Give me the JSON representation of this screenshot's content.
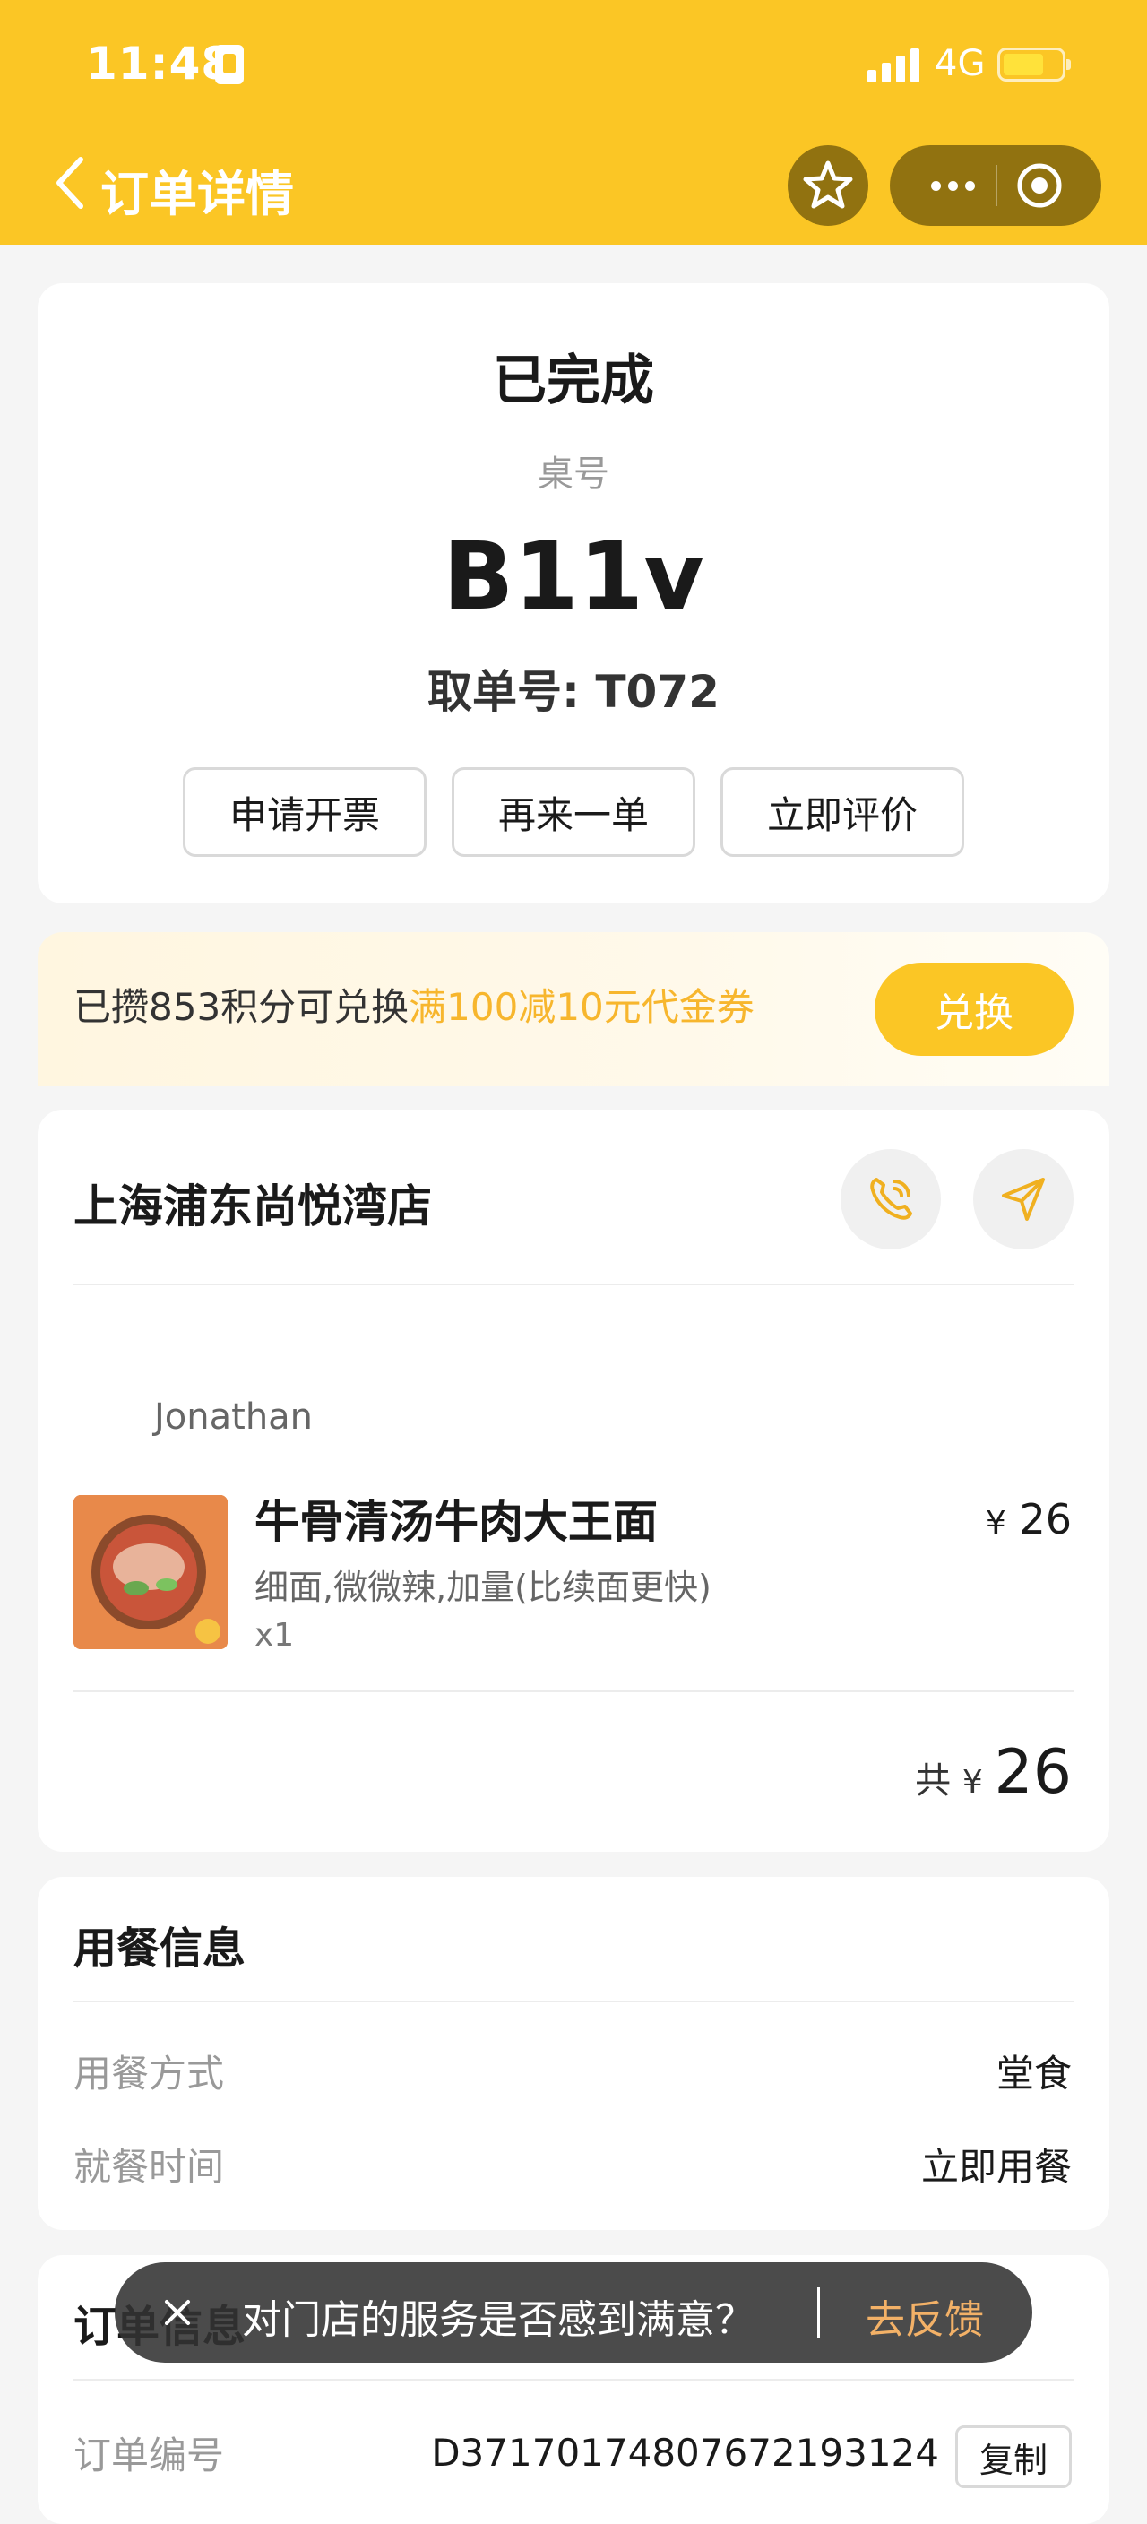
{
  "status_bar": {
    "time": "11:48",
    "network": "4G"
  },
  "nav": {
    "title": "订单详情"
  },
  "order": {
    "status": "已完成",
    "table_label": "桌号",
    "table_number": "B11v",
    "pickup": "取单号: T072",
    "actions": [
      "申请开票",
      "再来一单",
      "立即评价"
    ]
  },
  "points": {
    "prefix": "已攒853积分可兑换",
    "highlight": "满100减10元代金券",
    "button": "兑换"
  },
  "store": {
    "name": "上海浦东尚悦湾店",
    "diner": "Jonathan",
    "item": {
      "name": "牛骨清汤牛肉大王面",
      "options": "细面,微微辣,加量(比续面更快)",
      "qty": "x1",
      "currency": "¥",
      "price": "26"
    },
    "total_prefix": "共",
    "total_currency": "¥",
    "total": "26"
  },
  "dining": {
    "title": "用餐信息",
    "rows": [
      {
        "label": "用餐方式",
        "value": "堂食"
      },
      {
        "label": "就餐时间",
        "value": "立即用餐"
      }
    ]
  },
  "order_info": {
    "title": "订单信息",
    "number_label": "订单编号",
    "number": "D37170174807672193124",
    "copy": "复制"
  },
  "toast": {
    "message": "对门店的服务是否感到满意？",
    "action": "去反馈"
  },
  "colors": {
    "brand": "#fbc625",
    "highlight": "#f7b62d",
    "feedback": "#f3b167"
  },
  "icons": [
    "back-icon",
    "star-icon",
    "more-icon",
    "target-icon",
    "phone-icon",
    "navigation-icon",
    "close-icon"
  ]
}
